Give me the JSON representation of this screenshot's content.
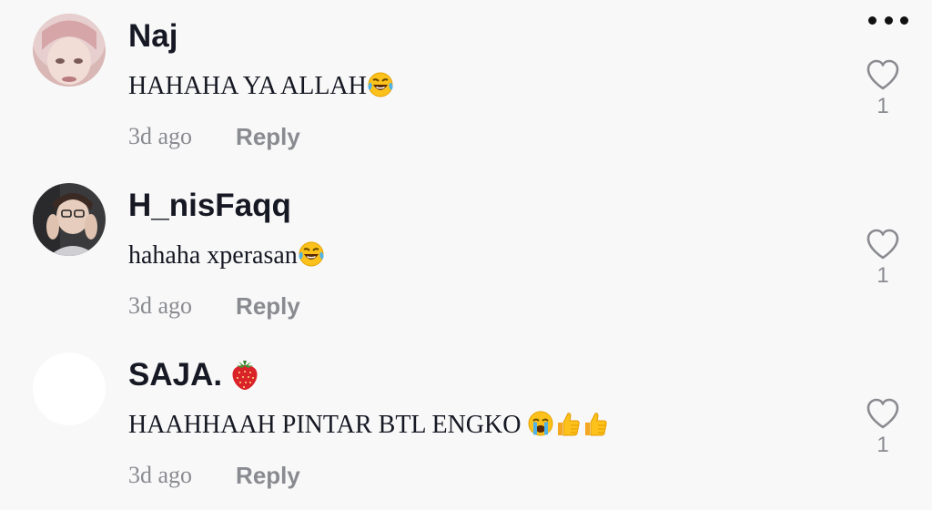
{
  "comments": [
    {
      "username": "Naj",
      "text": "HAHAHA YA ALLAH",
      "text_emojis": [
        "face-with-tears-of-joy"
      ],
      "timestamp": "3d ago",
      "reply_label": "Reply",
      "like_count": "1"
    },
    {
      "username": "H_nisFaqq",
      "text": "hahaha xperasan",
      "text_emojis": [
        "face-with-tears-of-joy"
      ],
      "timestamp": "3d ago",
      "reply_label": "Reply",
      "like_count": "1"
    },
    {
      "username": "SAJA.",
      "username_emoji": "strawberry",
      "text": "HAAHHAAH PINTAR BTL ENGKO ",
      "text_emojis": [
        "loudly-crying-face",
        "thumbs-up",
        "thumbs-up"
      ],
      "timestamp": "3d ago",
      "reply_label": "Reply",
      "like_count": "1"
    }
  ],
  "icons": {
    "more": "more-dots-icon",
    "like": "heart-outline-icon"
  },
  "colors": {
    "background": "#f8f8f8",
    "username": "#161823",
    "text": "#161823",
    "muted": "#8a8b91"
  }
}
